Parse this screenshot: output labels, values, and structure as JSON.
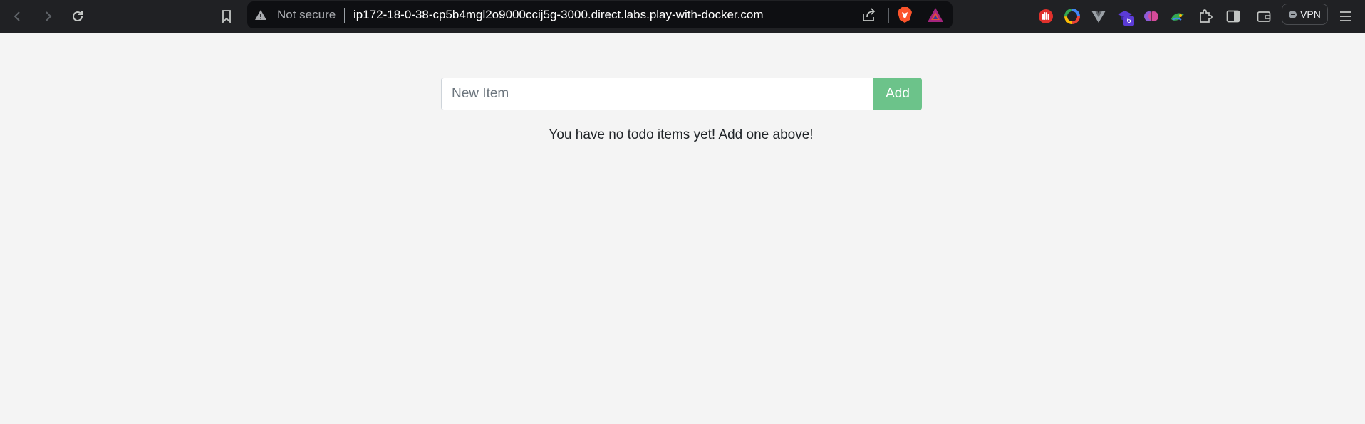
{
  "browser": {
    "security_label": "Not secure",
    "url": "ip172-18-0-38-cp5b4mgl2o9000ccij5g-3000.direct.labs.play-with-docker.com",
    "extension_badge_count": "6",
    "vpn_label": "VPN"
  },
  "todo": {
    "input_placeholder": "New Item",
    "add_label": "Add",
    "empty_message": "You have no todo items yet! Add one above!"
  },
  "colors": {
    "toolbar_bg": "#202124",
    "page_bg": "#f4f4f4",
    "add_button": "#6cc38a"
  }
}
